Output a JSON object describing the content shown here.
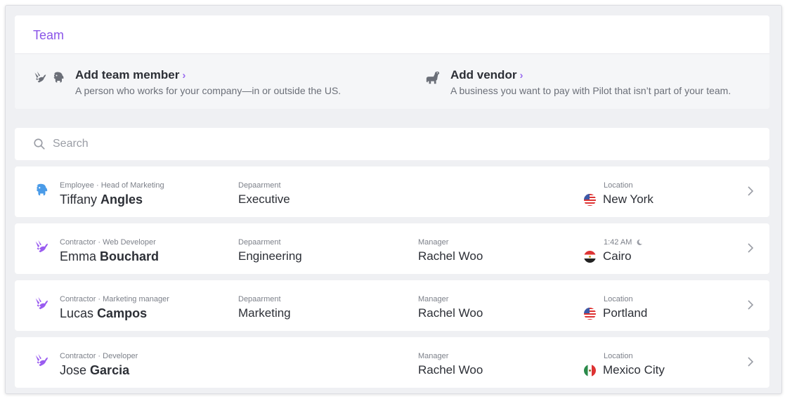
{
  "header": {
    "title": "Team",
    "add_member": {
      "title": "Add team member",
      "subtitle": "A person who works for your company—in or outside the US.",
      "icons": [
        "rabbit-icon",
        "elephant-icon"
      ]
    },
    "add_vendor": {
      "title": "Add vendor",
      "subtitle": "A business you want to pay with Pilot that isn’t part of your team.",
      "icons": [
        "dinosaur-icon"
      ]
    },
    "chevron": "›"
  },
  "search": {
    "placeholder": "Search"
  },
  "rows": [
    {
      "role": "Employee · Head of Marketing",
      "first_name": "Tiffany",
      "last_name": "Angles",
      "department_label": "Depaarment",
      "department": "Executive",
      "manager_label": "",
      "manager": "",
      "location_label": "Location",
      "location": "New York",
      "flag": "us",
      "avatar": "elephant-icon",
      "avatar_color": "#4a9be8"
    },
    {
      "role": "Contractor · Web Developer",
      "first_name": "Emma",
      "last_name": "Bouchard",
      "department_label": "Depaarment",
      "department": "Engineering",
      "manager_label": "Manager",
      "manager": "Rachel Woo",
      "location_label": "1:42 AM",
      "location": "Cairo",
      "flag": "eg",
      "avatar": "rabbit-icon",
      "avatar_color": "#9a5cf0"
    },
    {
      "role": "Contractor · Marketing manager",
      "first_name": "Lucas",
      "last_name": "Campos",
      "department_label": "Depaarment",
      "department": "Marketing",
      "manager_label": "Manager",
      "manager": "Rachel Woo",
      "location_label": "Location",
      "location": "Portland",
      "flag": "us",
      "avatar": "rabbit-icon",
      "avatar_color": "#9a5cf0"
    },
    {
      "role": "Contractor · Developer",
      "first_name": "Jose",
      "last_name": "Garcia",
      "department_label": "",
      "department": "",
      "manager_label": "Manager",
      "manager": "Rachel Woo",
      "location_label": "Location",
      "location": "Mexico City",
      "flag": "mx",
      "avatar": "rabbit-icon",
      "avatar_color": "#9a5cf0"
    }
  ],
  "colors": {
    "accent": "#8a55e8",
    "elephant_blue": "#4a9be8",
    "rabbit_purple": "#9a5cf0",
    "background": "#eff0f3"
  }
}
